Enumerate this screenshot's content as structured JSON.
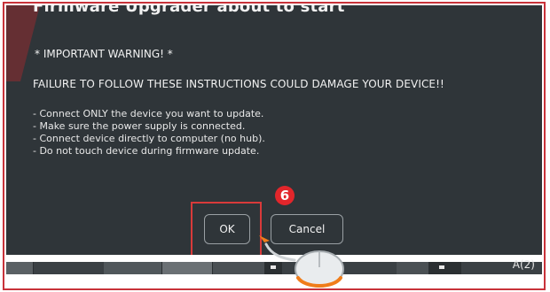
{
  "dialog": {
    "title": "Firmware Upgrader about to start",
    "warning_heading": "* IMPORTANT WARNING! *",
    "failure_notice": "FAILURE TO FOLLOW THESE INSTRUCTIONS COULD DAMAGE YOUR DEVICE!!",
    "instructions": [
      "- Connect ONLY the device you want to update.",
      "- Make sure the power supply is connected.",
      "- Connect device directly to computer (no hub).",
      "- Do not touch device during firmware update."
    ],
    "ok_label": "OK",
    "cancel_label": "Cancel"
  },
  "annotation": {
    "step_number": "6"
  },
  "taskbar": {
    "corner_label": "A(2)"
  },
  "colors": {
    "dialog_bg": "#2f3539",
    "highlight": "#d93a3a",
    "badge": "#e2262b",
    "mouse_accent": "#f07d1a"
  }
}
